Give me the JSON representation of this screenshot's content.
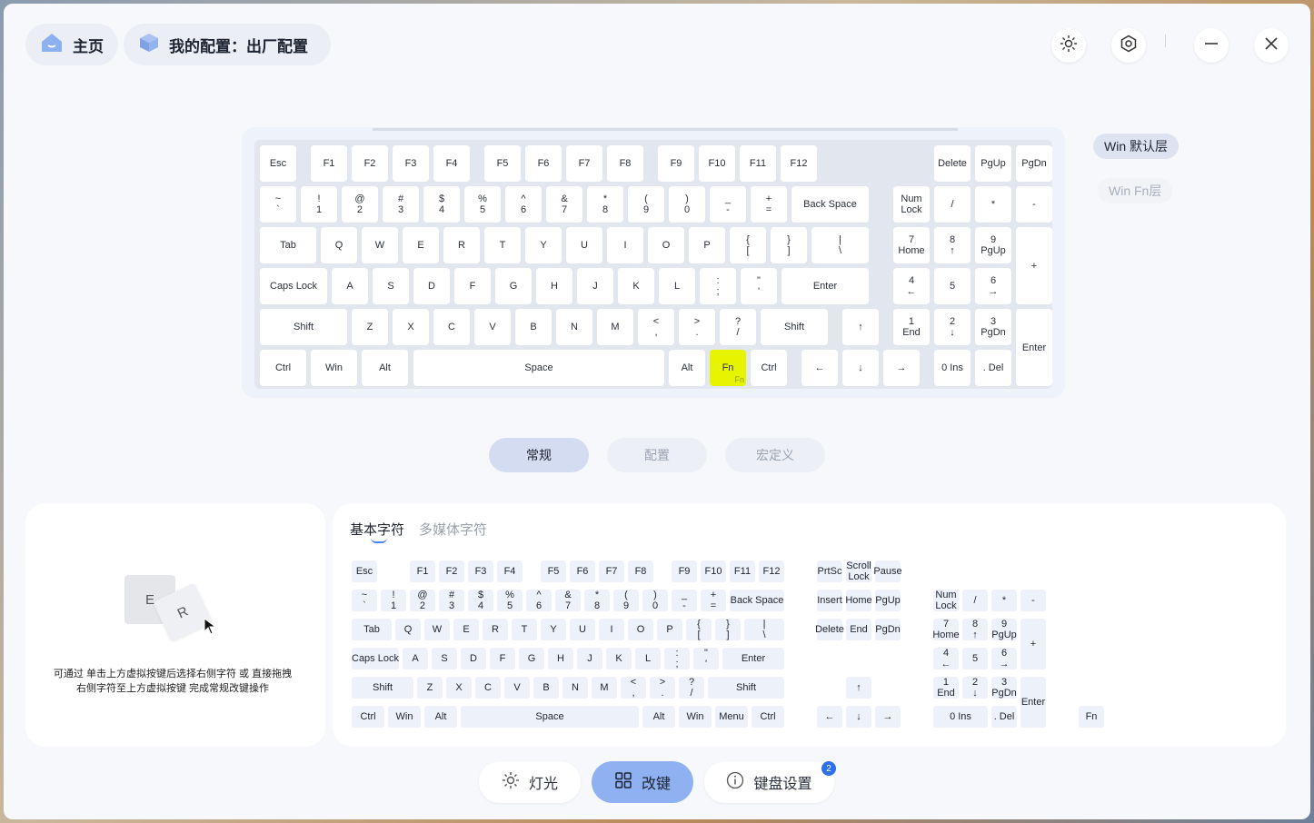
{
  "header": {
    "home_label": "主页",
    "profile_label": "我的配置：出厂配置"
  },
  "icons": {
    "home": "home-icon",
    "profile": "cube-icon",
    "theme": "sun-icon",
    "settings": "hexagon-gear-icon",
    "minimize": "minimize-icon",
    "close": "close-icon"
  },
  "layers": {
    "default_label": "Win 默认层",
    "fn_label": "Win Fn层"
  },
  "tabs": {
    "normal": "常规",
    "config": "配置",
    "macro": "宏定义"
  },
  "demo": {
    "key1": "E",
    "key2": "R",
    "hint_line1": "可通过 单击上方虚拟按键后选择右侧字符 或 直接拖拽",
    "hint_line2": "右侧字符至上方虚拟按键 完成常规改键操作"
  },
  "char_tabs": {
    "basic": "基本字符",
    "media": "多媒体字符"
  },
  "bottom_nav": {
    "light": "灯光",
    "remap": "改键",
    "settings": "键盘设置",
    "badge": "2"
  },
  "colors": {
    "accent": "#8fb1f2",
    "fn_highlight": "#e6f400",
    "badge": "#2f6fe8"
  },
  "kb_keys": [
    "Esc",
    "F1",
    "F2",
    "F3",
    "F4",
    "F5",
    "F6",
    "F7",
    "F8",
    "F9",
    "F10",
    "F11",
    "F12",
    "Delete",
    "PgUp",
    "PgDn",
    "~\n`",
    "!\n1",
    "@\n2",
    "#\n3",
    "$\n4",
    "%\n5",
    "^\n6",
    "&\n7",
    "*\n8",
    "(\n9",
    ")\n0",
    "_\n-",
    "+\n=",
    "Back Space",
    "Num\nLock",
    "/",
    "*",
    "-",
    "Tab",
    "Q",
    "W",
    "E",
    "R",
    "T",
    "Y",
    "U",
    "I",
    "O",
    "P",
    "{\n[",
    "}\n]",
    "|\n\\",
    "7\nHome",
    "8\n↑",
    "9\nPgUp",
    "+",
    "Caps Lock",
    "A",
    "S",
    "D",
    "F",
    "G",
    "H",
    "J",
    "K",
    "L",
    ":\n;",
    "\"\n'",
    "Enter",
    "4\n←",
    "5",
    "6\n→",
    "Shift",
    "Z",
    "X",
    "C",
    "V",
    "B",
    "N",
    "M",
    "<\n,",
    ">\n.",
    "?\n/",
    "Shift",
    "↑",
    "1\nEnd",
    "2\n↓",
    "3\nPgDn",
    "Enter",
    "Ctrl",
    "Win",
    "Alt",
    "Space",
    "Alt",
    "Fn",
    "Ctrl",
    "←",
    "↓",
    "→",
    "0 Ins",
    ". Del"
  ],
  "fn_key_sublabel": "Fn",
  "sel_keys": [
    "Esc",
    "F1",
    "F2",
    "F3",
    "F4",
    "F5",
    "F6",
    "F7",
    "F8",
    "F9",
    "F10",
    "F11",
    "F12",
    "PrtSc",
    "Scroll\nLock",
    "Pause",
    "~\n`",
    "!\n1",
    "@\n2",
    "#\n3",
    "$\n4",
    "%\n5",
    "^\n6",
    "&\n7",
    "*\n8",
    "(\n9",
    ")\n0",
    "_\n-",
    "+\n=",
    "Back Space",
    "Insert",
    "Home",
    "PgUp",
    "Num\nLock",
    "/",
    "*",
    "-",
    "Tab",
    "Q",
    "W",
    "E",
    "R",
    "T",
    "Y",
    "U",
    "I",
    "O",
    "P",
    "{\n[",
    "}\n]",
    "|\n\\",
    "Delete",
    "End",
    "PgDn",
    "7\nHome",
    "8\n↑",
    "9\nPgUp",
    "+",
    "Caps Lock",
    "A",
    "S",
    "D",
    "F",
    "G",
    "H",
    "J",
    "K",
    "L",
    ":\n;",
    "\"\n'",
    "Enter",
    "4\n←",
    "5",
    "6\n→",
    "Shift",
    "Z",
    "X",
    "C",
    "V",
    "B",
    "N",
    "M",
    "<\n,",
    ">\n.",
    "?\n/",
    "Shift",
    "↑",
    "1\nEnd",
    "2\n↓",
    "3\nPgDn",
    "Enter",
    "Ctrl",
    "Win",
    "Alt",
    "Space",
    "Alt",
    "Win",
    "Menu",
    "Ctrl",
    "←",
    "↓",
    "→",
    "0 Ins",
    ". Del",
    "Fn"
  ]
}
